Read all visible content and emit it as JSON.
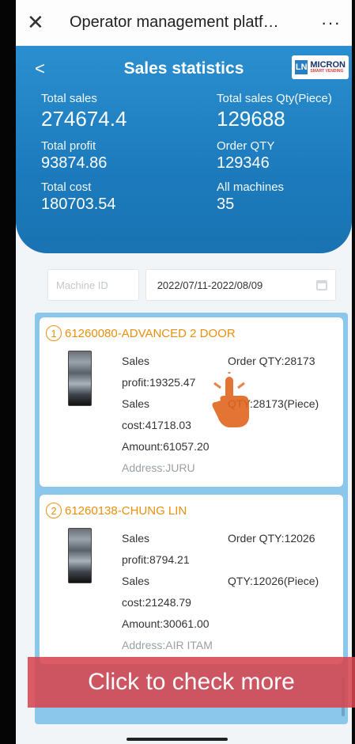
{
  "wechat": {
    "close_icon": "close-icon",
    "title": "Operator management platf…",
    "more": "···"
  },
  "header": {
    "back": "<",
    "title": "Sales statistics",
    "logo_mark": "LN",
    "logo_text": "MICRON",
    "logo_sub": "SMART VENDING"
  },
  "stats": {
    "total_sales_label": "Total sales",
    "total_sales": "274674.4",
    "total_sales_qty_label": "Total sales Qty(Piece)",
    "total_sales_qty": "129688",
    "total_profit_label": "Total profit",
    "total_profit": "93874.86",
    "order_qty_label": "Order QTY",
    "order_qty": "129346",
    "total_cost_label": "Total cost",
    "total_cost": "180703.54",
    "all_machines_label": "All machines",
    "all_machines": "35"
  },
  "filters": {
    "machine_placeholder": "Machine ID",
    "date_range": "2022/07/11-2022/08/09"
  },
  "machines": [
    {
      "num": "1",
      "title": "61260080-ADVANCED 2 DOOR",
      "sales_profit_a": "Sales",
      "sales_profit_b": "profit:19325.47",
      "sales_cost_a": "Sales",
      "sales_cost_b": "cost:41718.03",
      "amount": "Amount:61057.20",
      "address": "Address:JURU",
      "order_qty": "Order QTY:28173",
      "qty": "QTY:28173(Piece)"
    },
    {
      "num": "2",
      "title": "61260138-CHUNG LIN",
      "sales_profit_a": "Sales",
      "sales_profit_b": "profit:8794.21",
      "sales_cost_a": "Sales",
      "sales_cost_b": "cost:21248.79",
      "amount": "Amount:30061.00",
      "address": "Address:AIR ITAM",
      "order_qty": "Order QTY:12026",
      "qty": "QTY:12026(Piece)"
    }
  ],
  "overlay": {
    "check_more": "Click to check more"
  },
  "colors": {
    "header_blue": "#1c7bbd",
    "accent_orange": "#e8900f",
    "overlay_red": "#d6464e",
    "list_bg": "#8bc7ea"
  }
}
